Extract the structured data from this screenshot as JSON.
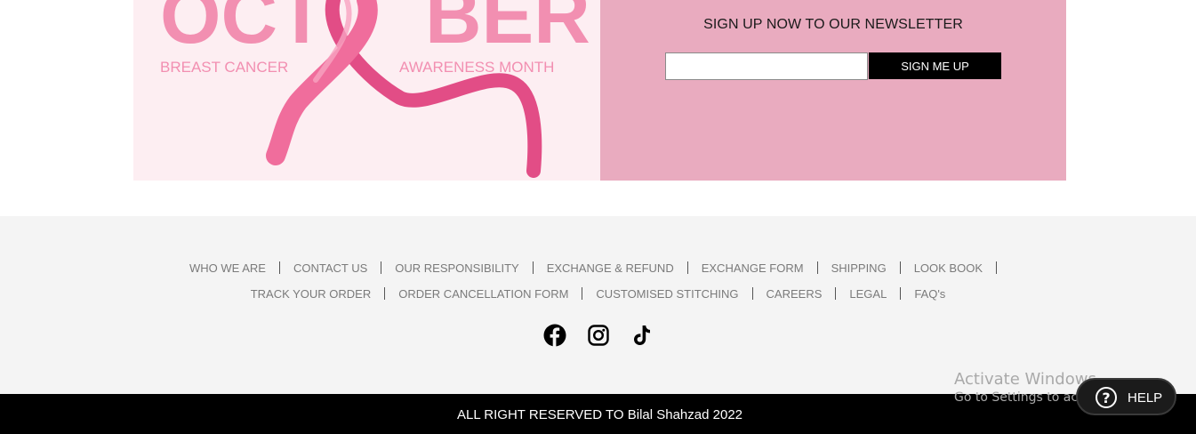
{
  "banner": {
    "image_heading": "OCTOBER",
    "image_left_caption": "BREAST CANCER",
    "image_right_caption": "AWARENESS MONTH",
    "newsletter_title": "SIGN UP NOW TO OUR NEWSLETTER",
    "email_value": "",
    "email_placeholder": "",
    "signup_label": "SIGN ME UP",
    "colors": {
      "image_bg": "#fdeef2",
      "panel_bg": "#e9abbf",
      "pink_text": "#f28fb1"
    }
  },
  "footer": {
    "row1": [
      "WHO WE ARE",
      "CONTACT US",
      "OUR RESPONSIBILITY",
      "EXCHANGE & REFUND",
      "EXCHANGE FORM",
      "SHIPPING",
      "LOOK BOOK"
    ],
    "row2": [
      "TRACK YOUR ORDER",
      "ORDER CANCELLATION FORM",
      "CUSTOMISED STITCHING",
      "CAREERS",
      "LEGAL",
      "FAQ's"
    ],
    "social": [
      "facebook-icon",
      "instagram-icon",
      "tiktok-icon"
    ]
  },
  "bottom_bar": {
    "copyright": "ALL RIGHT RESERVED TO Bilal Shahzad 2022"
  },
  "watermark": {
    "line1": "Activate Windows",
    "line2": "Go to Settings to activate Windows."
  },
  "help": {
    "label": "HELP",
    "icon": "question-circle-icon"
  }
}
